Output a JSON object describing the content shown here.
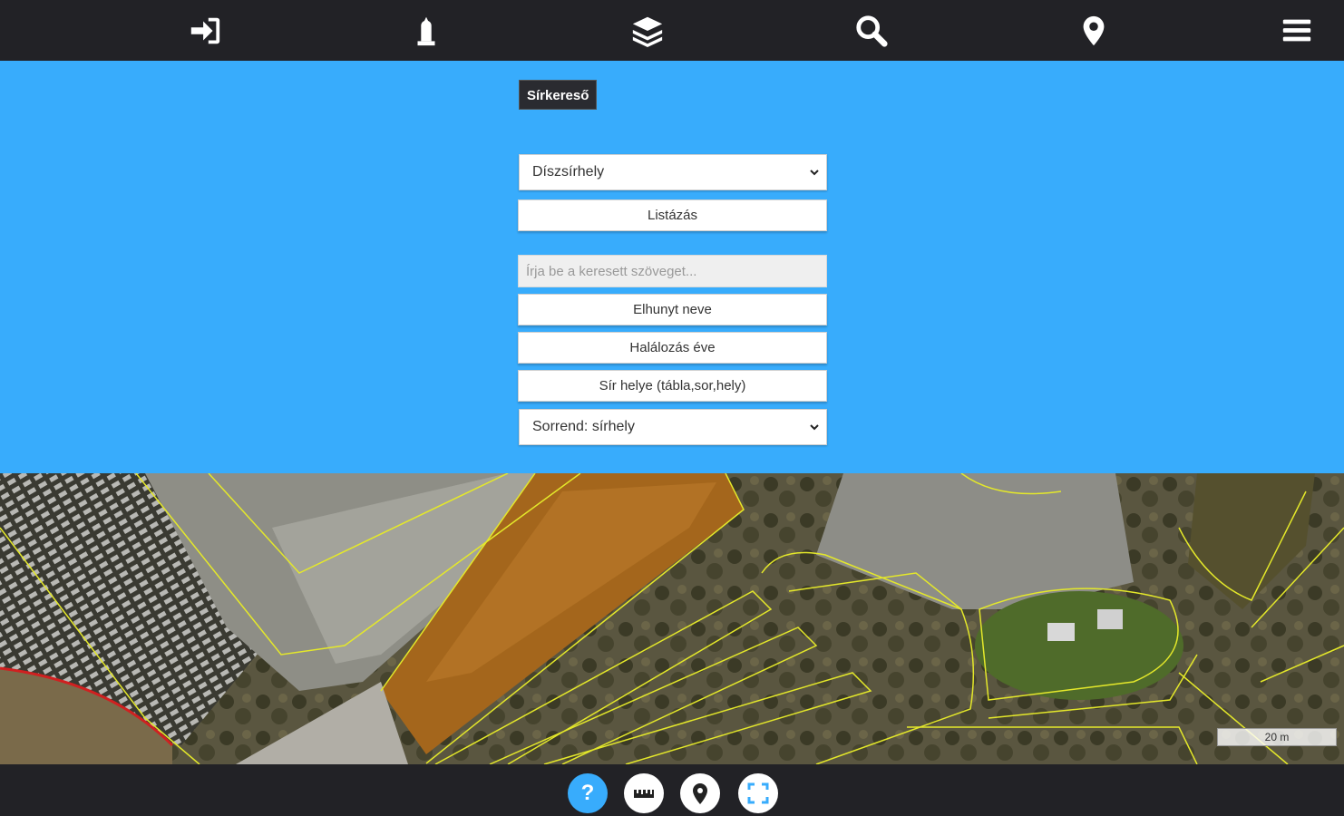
{
  "toolbar": {
    "icons": [
      "sign-in-icon",
      "tombstone-icon",
      "layers-icon",
      "search-icon",
      "map-marker-icon",
      "menu-icon"
    ]
  },
  "search_panel": {
    "title": "Sírkereső",
    "category_select": "Díszsírhely",
    "list_button": "Listázás",
    "search_placeholder": "Írja be a keresett szöveget...",
    "deceased_name_button": "Elhunyt neve",
    "death_year_button": "Halálozás éve",
    "grave_location_button": "Sír helye (tábla,sor,hely)",
    "sort_select": "Sorrend: sírhely"
  },
  "map": {
    "scale_label": "20 m"
  },
  "bottom_controls": {
    "icons": [
      "help-icon",
      "measure-icon",
      "location-icon",
      "fullscreen-icon"
    ],
    "help_glyph": "?"
  },
  "colors": {
    "panel_background": "#38acfc",
    "bar_background": "#222226",
    "help_button": "#38acfc"
  }
}
